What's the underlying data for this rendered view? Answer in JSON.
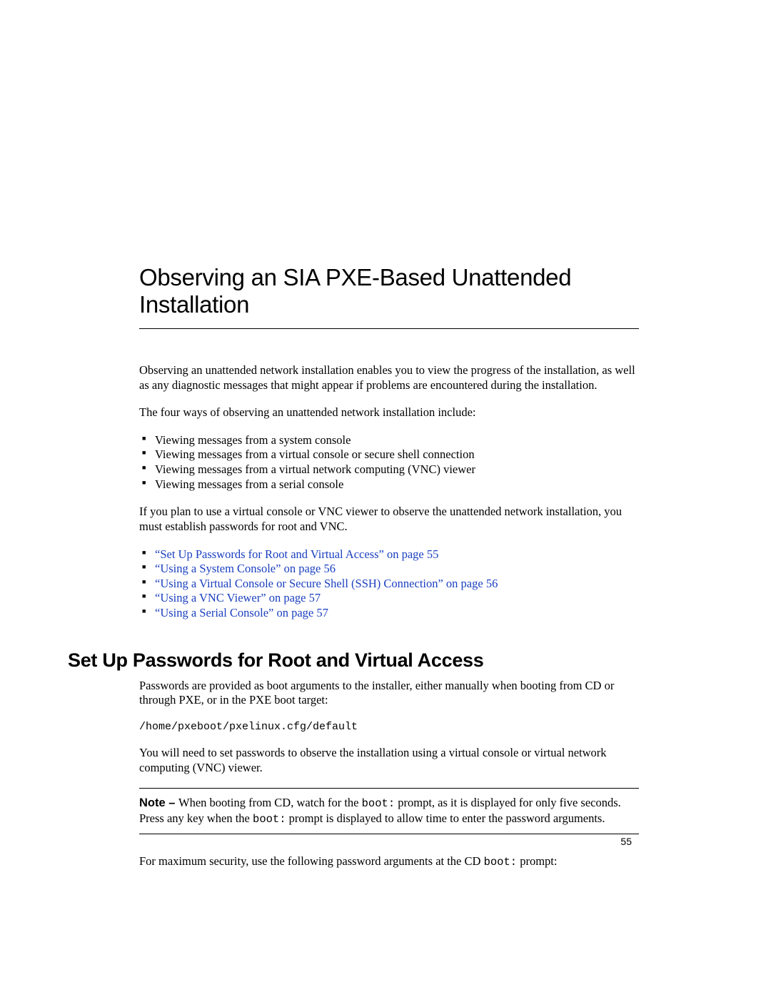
{
  "title": "Observing an SIA PXE-Based Unattended Installation",
  "intro1": "Observing an unattended network installation enables you to view the progress of the installation, as well as any diagnostic messages that might appear if problems are encountered during the installation.",
  "intro2": "The four ways of observing an unattended network installation include:",
  "ways": [
    "Viewing messages from a system console",
    "Viewing messages from a virtual console or secure shell connection",
    "Viewing messages from a virtual network computing (VNC) viewer",
    "Viewing messages from a serial console"
  ],
  "intro3": "If you plan to use a virtual console or VNC viewer to observe the unattended network installation, you must establish passwords for root and VNC.",
  "links": [
    "“Set Up Passwords for Root and Virtual Access” on page 55",
    "“Using a System Console” on page 56",
    "“Using a Virtual Console or Secure Shell (SSH) Connection” on page 56",
    "“Using a VNC Viewer” on page 57",
    "“Using a Serial Console” on page 57"
  ],
  "section_heading": "Set Up Passwords for Root and Virtual Access",
  "sec_p1": "Passwords are provided as boot arguments to the installer, either manually when booting from CD or through PXE, or in the PXE boot target:",
  "codepath": "/home/pxeboot/pxelinux.cfg/default",
  "sec_p2": "You will need to set passwords to observe the installation using a virtual console or virtual network computing (VNC) viewer.",
  "note_label": "Note – ",
  "note_pre": "When booting from CD, watch for the ",
  "note_code1": "boot:",
  "note_mid": " prompt, as it is displayed for only five seconds. Press any key when the ",
  "note_code2": "boot:",
  "note_post": " prompt is displayed to allow time to enter the password arguments.",
  "sec_p3_pre": "For maximum security, use the following password arguments at the CD ",
  "sec_p3_code": "boot:",
  "sec_p3_post": " prompt:",
  "pagenum": "55"
}
